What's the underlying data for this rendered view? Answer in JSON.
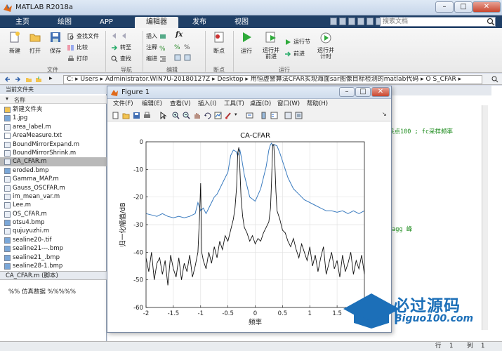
{
  "app": {
    "title": "MATLAB R2018a",
    "win_minimize": "–",
    "win_maximize": "□",
    "win_close": "✕"
  },
  "tabs": [
    {
      "label": "主页"
    },
    {
      "label": "绘图"
    },
    {
      "label": "APP"
    },
    {
      "label": "编辑器",
      "active": true
    },
    {
      "label": "发布"
    },
    {
      "label": "视图"
    }
  ],
  "search": {
    "placeholder": "搜索文档"
  },
  "ribbon": {
    "file": {
      "group": "文件",
      "new": "新建",
      "open": "打开",
      "save": "保存",
      "find_files": "查找文件",
      "compare": "比较",
      "print": "打印"
    },
    "navigate": {
      "group": "导航",
      "goto": "转至",
      "find": "查找"
    },
    "edit": {
      "group": "编辑",
      "insert": "插入",
      "comment": "注释",
      "indent": "缩进",
      "fx": "fx"
    },
    "breakpoints": {
      "group": "断点",
      "breakpoints": "断点"
    },
    "run": {
      "group": "运行",
      "run": "运行",
      "run_advance_1": "运行并",
      "run_advance_2": "前进",
      "run_section": "运行节",
      "advance": "前进",
      "run_time_1": "运行并",
      "run_time_2": "计时"
    }
  },
  "addressbar": {
    "path": "C: ▸ Users ▸ Administrator.WIN7U-20180127Z ▸ Desktop ▸ 用恒虚警算法CFAR实现海面sar图像目标检测的matlab代码 ▸ O S_CFAR ▸"
  },
  "current_folder": {
    "header": "当前文件夹",
    "column_name": "名称",
    "items": [
      {
        "name": "新建文件夹",
        "type": "folder"
      },
      {
        "name": "1.jpg",
        "type": "img"
      },
      {
        "name": "area_label.m",
        "type": "m"
      },
      {
        "name": "AreaMeasure.txt",
        "type": "txt"
      },
      {
        "name": "BoundMirrorExpand.m",
        "type": "m"
      },
      {
        "name": "BoundMirrorShrink.m",
        "type": "m"
      },
      {
        "name": "CA_CFAR.m",
        "type": "m",
        "selected": true
      },
      {
        "name": "eroded.bmp",
        "type": "img"
      },
      {
        "name": "Gamma_MAP.m",
        "type": "m"
      },
      {
        "name": "Gauss_OSCFAR.m",
        "type": "m"
      },
      {
        "name": "im_mean_var.m",
        "type": "m"
      },
      {
        "name": "Lee.m",
        "type": "m"
      },
      {
        "name": "OS_CFAR.m",
        "type": "m"
      },
      {
        "name": "otsu4.bmp",
        "type": "img"
      },
      {
        "name": "qujuyuzhi.m",
        "type": "m"
      },
      {
        "name": "sealine20-.tif",
        "type": "img"
      },
      {
        "name": "sealine21---.bmp",
        "type": "img"
      },
      {
        "name": "sealine21_.bmp",
        "type": "img"
      },
      {
        "name": "sealine28-1.bmp",
        "type": "img"
      }
    ],
    "details_title": "CA_CFAR.m  (脚本)",
    "details_body": "%%  仿真数据  %%%%%"
  },
  "editor_bg": {
    "header_text": "图像目标检测的matlab代码\\",
    "code_line1": "采点100 ; fc采样频率",
    "code_line2": "ragg 峰"
  },
  "status": {
    "row_label": "行",
    "row_value": "1",
    "col_label": "列",
    "col_value": "1"
  },
  "figure": {
    "title": "Figure 1",
    "menu": [
      "文件(F)",
      "编辑(E)",
      "查看(V)",
      "插入(I)",
      "工具(T)",
      "桌面(D)",
      "窗口(W)",
      "帮助(H)"
    ]
  },
  "watermark": {
    "text1": "必过源码",
    "text2": "Biguo100.com"
  },
  "chart_data": {
    "type": "line",
    "title": "CA-CFAR",
    "xlabel": "频率",
    "ylabel": "归一化幅值/dB",
    "xlim": [
      -2,
      2
    ],
    "ylim": [
      -60,
      0
    ],
    "xticks": [
      -2,
      -1.5,
      -1,
      -0.5,
      0,
      0.5,
      1,
      1.5,
      2
    ],
    "yticks": [
      0,
      -10,
      -20,
      -30,
      -40,
      -50,
      -60
    ],
    "xtick_labels": [
      "-2",
      "-1.5",
      "-1",
      "-0.5",
      "0",
      "0.5",
      "1",
      "1.5",
      "2"
    ],
    "ytick_labels": [
      "0",
      "-10",
      "-20",
      "-30",
      "-40",
      "-50",
      "-60"
    ],
    "grid": true,
    "series": [
      {
        "color": "#3a7bbf",
        "x": [
          -2,
          -1.9,
          -1.8,
          -1.7,
          -1.6,
          -1.5,
          -1.4,
          -1.3,
          -1.2,
          -1.1,
          -1.05,
          -1.0,
          -0.95,
          -0.9,
          -0.85,
          -0.8,
          -0.75,
          -0.7,
          -0.65,
          -0.6,
          -0.55,
          -0.5,
          -0.45,
          -0.4,
          -0.35,
          -0.32,
          -0.3,
          -0.28,
          -0.25,
          -0.2,
          -0.1,
          0,
          0.1,
          0.2,
          0.25,
          0.28,
          0.3,
          0.32,
          0.35,
          0.4,
          0.45,
          0.5,
          0.55,
          0.6,
          0.7,
          0.8,
          0.9,
          1.0,
          1.1,
          1.2,
          1.3,
          1.4,
          1.5,
          1.6,
          1.7,
          1.8,
          1.9,
          2.0
        ],
        "y": [
          -26,
          -26.5,
          -27,
          -26,
          -27,
          -27.5,
          -27,
          -27.5,
          -27,
          -26,
          -22,
          -25,
          -24,
          -26,
          -24,
          -22,
          -20,
          -19,
          -17,
          -15,
          -13,
          -11,
          -5,
          -3,
          -3.5,
          -5,
          -4,
          -3,
          -6,
          -12,
          -20,
          -21.5,
          -17,
          -9,
          -3,
          -1,
          -0.5,
          -1.5,
          -1,
          -1.5,
          -4,
          -7,
          -10,
          -13,
          -17,
          -19,
          -21,
          -22,
          -23,
          -24,
          -25,
          -25,
          -25.5,
          -25,
          -26,
          -25,
          -26,
          -25
        ]
      },
      {
        "color": "#111111",
        "x": [
          -2,
          -1.95,
          -1.9,
          -1.85,
          -1.8,
          -1.75,
          -1.7,
          -1.65,
          -1.6,
          -1.55,
          -1.5,
          -1.45,
          -1.4,
          -1.35,
          -1.3,
          -1.25,
          -1.2,
          -1.15,
          -1.1,
          -1.05,
          -1.02,
          -1.0,
          -0.98,
          -0.95,
          -0.9,
          -0.85,
          -0.8,
          -0.75,
          -0.7,
          -0.65,
          -0.6,
          -0.55,
          -0.5,
          -0.45,
          -0.4,
          -0.37,
          -0.34,
          -0.32,
          -0.3,
          -0.28,
          -0.26,
          -0.23,
          -0.2,
          -0.15,
          -0.1,
          -0.05,
          0,
          0.05,
          0.1,
          0.15,
          0.2,
          0.25,
          0.28,
          0.3,
          0.32,
          0.34,
          0.36,
          0.38,
          0.4,
          0.45,
          0.5,
          0.55,
          0.6,
          0.65,
          0.7,
          0.75,
          0.8,
          0.85,
          0.9,
          0.95,
          1.0,
          1.05,
          1.1,
          1.15,
          1.2,
          1.25,
          1.3,
          1.35,
          1.4,
          1.45,
          1.5,
          1.55,
          1.6,
          1.65,
          1.7,
          1.75,
          1.8,
          1.85,
          1.9,
          1.95,
          2.0
        ],
        "y": [
          -42,
          -47,
          -40,
          -50,
          -44,
          -42,
          -48,
          -43,
          -52,
          -41,
          -46,
          -49,
          -42,
          -50,
          -44,
          -47,
          -41,
          -49,
          -45,
          -40,
          -27,
          -15,
          -40,
          -43,
          -46,
          -40,
          -44,
          -38,
          -42,
          -36,
          -39,
          -34,
          -36,
          -32,
          -28,
          -24,
          -16,
          -4,
          -2,
          -10,
          -20,
          -27,
          -31,
          -33,
          -36,
          -34,
          -37,
          -35,
          -36,
          -33,
          -31,
          -29,
          -24,
          -14,
          -1,
          -1,
          -8,
          -18,
          -25,
          -28,
          -32,
          -33,
          -36,
          -38,
          -35,
          -39,
          -42,
          -37,
          -40,
          -43,
          -38,
          -45,
          -41,
          -47,
          -42,
          -38,
          -48,
          -44,
          -40,
          -46,
          -43,
          -49,
          -41,
          -47,
          -44,
          -40,
          -48,
          -43,
          -46,
          -41,
          -48
        ]
      }
    ]
  }
}
